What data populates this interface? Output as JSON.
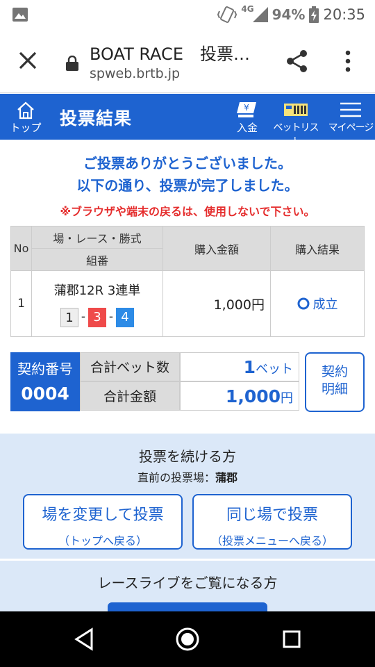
{
  "status_bar": {
    "network": "4G",
    "battery": "94%",
    "time": "20:35"
  },
  "browser": {
    "title": "BOAT RACE　投票…",
    "url": "spweb.brtb.jp"
  },
  "header": {
    "home_label": "トップ",
    "title": "投票結果",
    "deposit_label": "入金",
    "betlist_label": "ベットリスト",
    "mypage_label": "マイページ"
  },
  "messages": {
    "line1": "ご投票ありがとうございました。",
    "line2": "以下の通り、投票が完了しました。",
    "warning": "※ブラウザや端末の戻るは、使用しないで下さい。"
  },
  "table": {
    "col_no": "No",
    "col_race": "場・レース・勝式",
    "col_combo": "組番",
    "col_amount": "購入金額",
    "col_result": "購入結果",
    "rows": [
      {
        "no": "1",
        "race": "蒲郡12R 3連単",
        "combo": [
          "1",
          "3",
          "4"
        ],
        "amount": "1,000円",
        "result": "成立"
      }
    ]
  },
  "contract": {
    "label": "契約番号",
    "number": "0004",
    "bet_count_label": "合計ベット数",
    "bet_count": "1",
    "bet_unit": "ベット",
    "total_label": "合計金額",
    "total": "1,000",
    "total_unit": "円",
    "detail_line1": "契約",
    "detail_line2": "明細"
  },
  "continue": {
    "title": "投票を続ける方",
    "last_venue_label": "直前の投票場：",
    "last_venue": "蒲郡",
    "change_button": "場を変更して投票",
    "change_sub": "（トップへ戻る）",
    "same_button": "同じ場で投票",
    "same_sub": "（投票メニューへ戻る）"
  },
  "live": {
    "title": "レースライブをご覧になる方"
  },
  "colors": {
    "brand_blue": "#1e63d0",
    "warning_red": "#e52e2e",
    "section_bg": "#dbe8f8"
  }
}
